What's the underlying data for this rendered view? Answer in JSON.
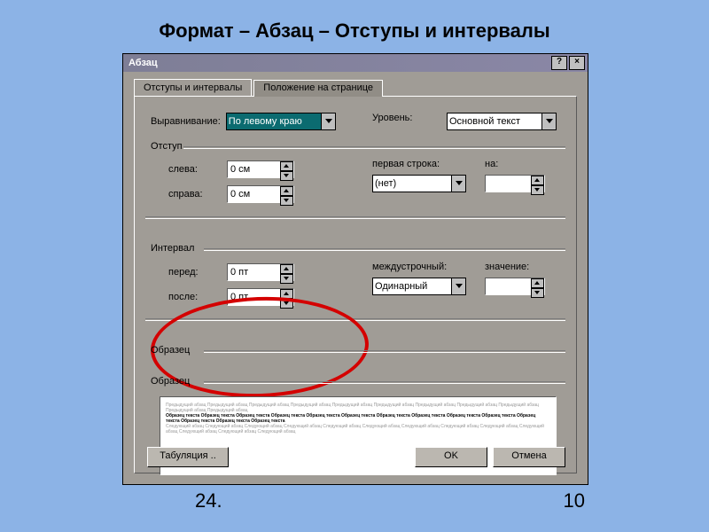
{
  "slide": {
    "title": "Формат – Абзац – Отступы и интервалы",
    "page_left": "24.",
    "page_right": "10"
  },
  "dialog": {
    "title": "Абзац",
    "help": "?",
    "close": "×",
    "tabs": {
      "active": "Отступы и интервалы",
      "inactive": "Положение на странице"
    },
    "alignment_label": "Выравнивание:",
    "alignment_value": "По левому краю",
    "level_label": "Уровень:",
    "level_value": "Основной текст",
    "indent_group": "Отступ",
    "left_label": "слева:",
    "left_value": "0 см",
    "right_label": "справа:",
    "right_value": "0 см",
    "firstline_label": "первая строка:",
    "firstline_value": "(нет)",
    "by1_label": "на:",
    "by1_value": "",
    "interval_group": "Интервал",
    "before_label": "перед:",
    "before_value": "0 пт",
    "after_label": "после:",
    "after_value": "0 пт",
    "linespacing_label": "междустрочный:",
    "linespacing_value": "Одинарный",
    "by2_label": "значение:",
    "by2_value": "",
    "sample_label": "Образец",
    "tabs_btn": "Табуляция ..",
    "ok": "OK",
    "cancel": "Отмена",
    "preview_grey1": "Предыдущий абзац Предыдущий абзац Предыдущий абзац Предыдущий абзац Предыдущий абзац Предыдущий абзац Предыдущий абзац Предыдущий абзац Предыдущий абзац Предыдущий абзац Предыдущий абзац",
    "preview_main": "Образец текста Образец текста Образец текста Образец текста Образец текста Образец текста Образец текста Образец текста Образец текста Образец текста Образец текста Образец текста Образец текста Образец текста",
    "preview_grey2": "Следующий абзац Следующий абзац Следующий абзац Следующий абзац Следующий абзац Следующий абзац Следующий абзац Следующий абзац Следующий абзац Следующий абзац Следующий абзац Следующий абзац Следующий абзац"
  }
}
